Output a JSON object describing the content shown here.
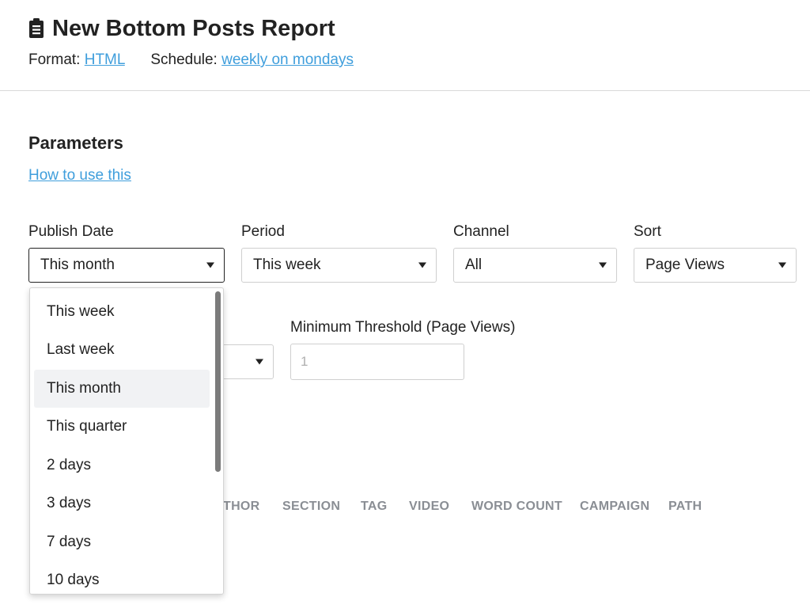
{
  "header": {
    "title": "New Bottom Posts Report",
    "format_label": "Format:",
    "format_value": "HTML",
    "schedule_label": "Schedule:",
    "schedule_value": "weekly on mondays"
  },
  "parameters": {
    "title": "Parameters",
    "help_link": "How to use this"
  },
  "fields": {
    "publish_date": {
      "label": "Publish Date",
      "value": "This month"
    },
    "period": {
      "label": "Period",
      "value": "This week"
    },
    "channel": {
      "label": "Channel",
      "value": "All"
    },
    "sort": {
      "label": "Sort",
      "value": "Page Views"
    },
    "min_threshold": {
      "label": "Minimum Threshold (Page Views)",
      "placeholder": "1"
    }
  },
  "column_tabs": [
    "THOR",
    "SECTION",
    "TAG",
    "VIDEO",
    "WORD COUNT",
    "CAMPAIGN",
    "PATH"
  ],
  "dropdown": {
    "options": [
      "This week",
      "Last week",
      "This month",
      "This quarter",
      "2 days",
      "3 days",
      "7 days",
      "10 days"
    ],
    "highlighted": "This month"
  },
  "colors": {
    "link": "#3f9edc",
    "text": "#222222",
    "muted_tab": "#8a8e94",
    "highlight_bg": "#f1f2f4"
  },
  "icons": {
    "report": "clipboard-icon",
    "caret": "caret-down-icon"
  }
}
